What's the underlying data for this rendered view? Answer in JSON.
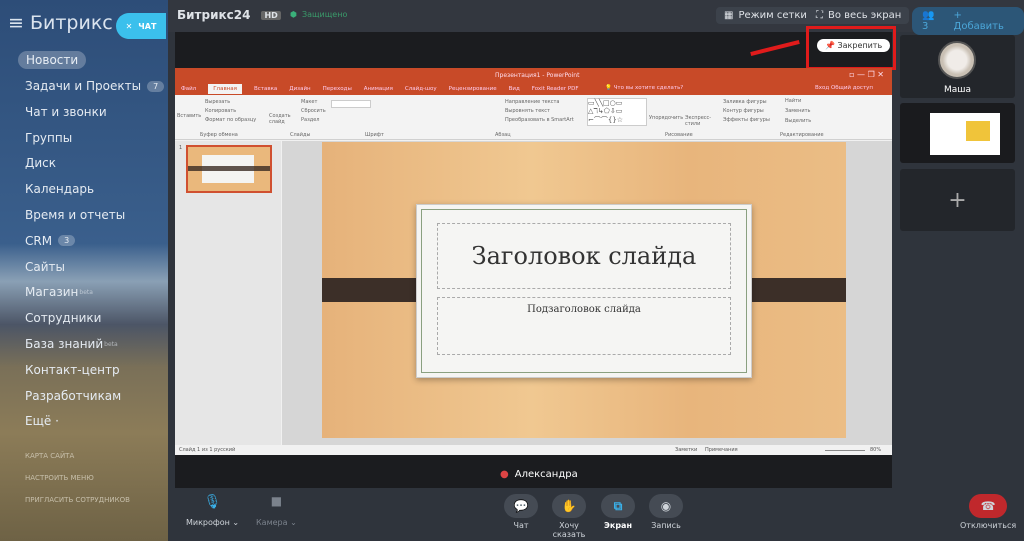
{
  "sidebar": {
    "logo_main": "Битрикс",
    "logo_num": "24",
    "chat_label": "ЧАТ",
    "active": "Новости",
    "items": [
      {
        "label": "Задачи и Проекты",
        "badge": "7"
      },
      {
        "label": "Чат и звонки"
      },
      {
        "label": "Группы"
      },
      {
        "label": "Диск"
      },
      {
        "label": "Календарь"
      },
      {
        "label": "Время и отчеты"
      },
      {
        "label": "CRM",
        "badge": "3"
      },
      {
        "label": "Сайты"
      },
      {
        "label": "Магазин",
        "sup": "beta"
      },
      {
        "label": "Сотрудники"
      },
      {
        "label": "База знаний",
        "sup": "beta"
      },
      {
        "label": "Контакт-центр"
      },
      {
        "label": "Разработчикам"
      },
      {
        "label": "Ещё ·"
      }
    ],
    "footer": [
      "КАРТА САЙТА",
      "НАСТРОИТЬ МЕНЮ",
      "ПРИГЛАСИТЬ СОТРУДНИКОВ"
    ]
  },
  "header": {
    "title": "Битрикс24",
    "hd": "HD",
    "secure": "Защищено",
    "grid": "Режим сетки",
    "fullscreen": "Во весь экран",
    "users": "3",
    "add": "Добавить"
  },
  "pin_label": "Закрепить",
  "ppt": {
    "title": "Презентация1 - PowerPoint",
    "tabs": [
      "Файл",
      "Главная",
      "Вставка",
      "Дизайн",
      "Переходы",
      "Анимация",
      "Слайд-шоу",
      "Рецензирование",
      "Вид",
      "Foxit Reader PDF"
    ],
    "tell": "Что вы хотите сделать?",
    "login": "Вход",
    "share": "Общий доступ",
    "groups": [
      "Буфер обмена",
      "Слайды",
      "Шрифт",
      "Абзац",
      "Рисование",
      "Редактирование"
    ],
    "ribbon": {
      "paste": "Вставить",
      "cut": "Вырезать",
      "copy": "Копировать",
      "format": "Формат по образцу",
      "new_slide": "Создать слайд",
      "layout": "Макет",
      "reset": "Сбросить",
      "section": "Раздел",
      "text_dir": "Направление текста",
      "align_text": "Выровнять текст",
      "smartart": "Преобразовать в SmartArt",
      "arrange": "Упорядочить",
      "styles": "Экспресс-стили",
      "fill": "Заливка фигуры",
      "outline": "Контур фигуры",
      "effects": "Эффекты фигуры",
      "find": "Найти",
      "replace": "Заменить",
      "select": "Выделить"
    },
    "slide_title": "Заголовок слайда",
    "slide_subtitle": "Подзаголовок слайда",
    "slide_num": "1",
    "status_left": "Слайд 1 из 1   русский",
    "notes": "Заметки",
    "comments": "Примечания",
    "zoom": "80%"
  },
  "speaker": "Александра",
  "right": {
    "participant": "Маша"
  },
  "controls": {
    "mic": "Микрофон",
    "camera": "Камера",
    "chat": "Чат",
    "raise": "Хочу сказать",
    "screen": "Экран",
    "record": "Запись",
    "hangup": "Отключиться"
  }
}
